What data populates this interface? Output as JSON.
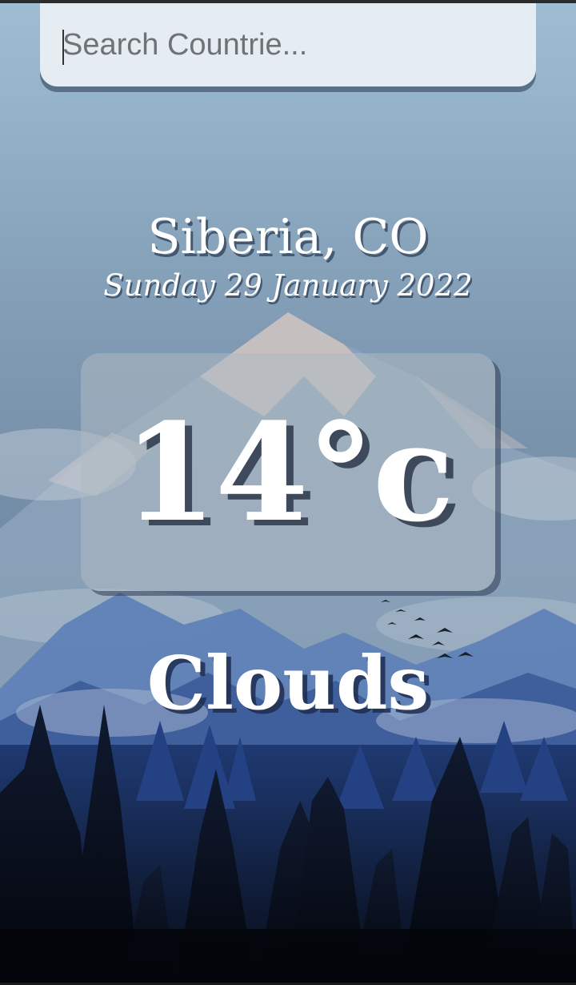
{
  "search": {
    "placeholder": "Search Countrie...",
    "value": ""
  },
  "location": {
    "name": "Siberia, CO"
  },
  "date": {
    "label": "Sunday 29 January 2022"
  },
  "weather": {
    "temperature_label": "14°c",
    "condition": "Clouds"
  },
  "colors": {
    "sky_top": "#a3bfd4",
    "sky_bottom": "#5e7a98",
    "mountain_far": "#6b8fbf",
    "mountain_snow": "#d7c7c0",
    "forest_dark": "#0b1220",
    "forest_mid": "#1e3566",
    "text": "#ffffff"
  }
}
